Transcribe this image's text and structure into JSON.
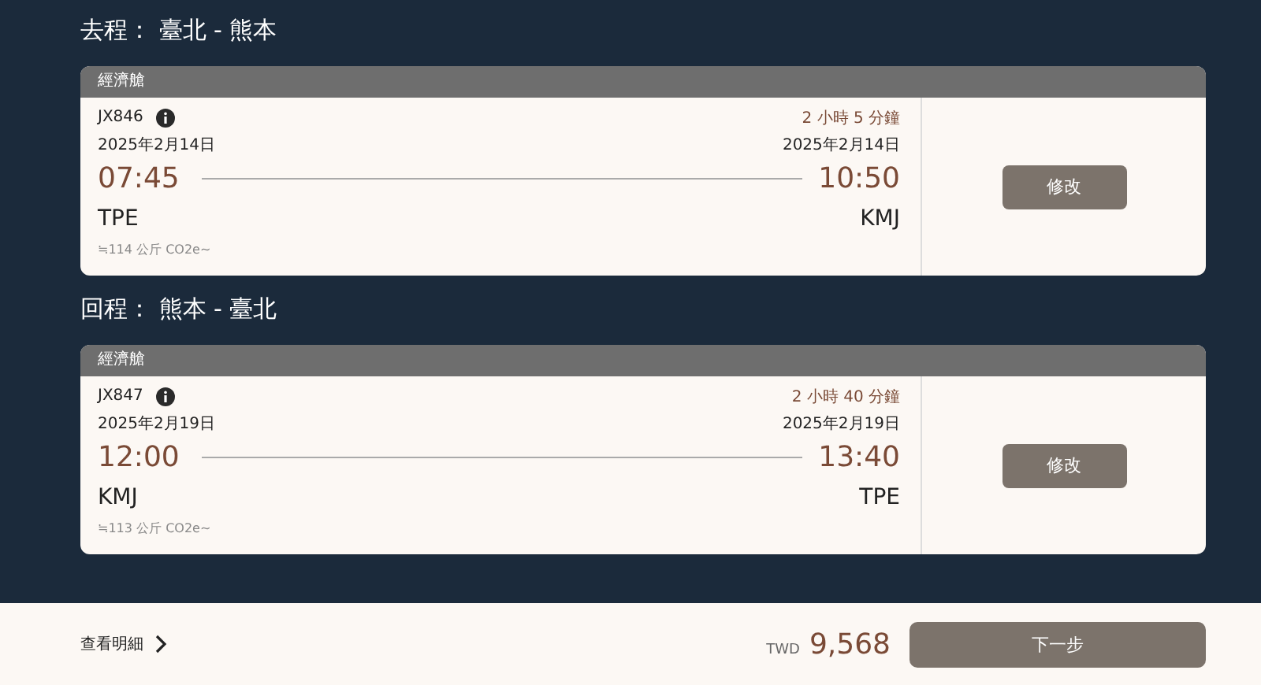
{
  "legs": [
    {
      "heading": "去程： 臺北 - 熊本",
      "cabin": "經濟艙",
      "flight": "JX846",
      "duration": "2 小時 5 分鐘",
      "dep_date": "2025年2月14日",
      "arr_date": "2025年2月14日",
      "dep_time": "07:45",
      "arr_time": "10:50",
      "dep_code": "TPE",
      "arr_code": "KMJ",
      "emission": "≒114 公斤 CO2e~",
      "button": "修改"
    },
    {
      "heading": "回程： 熊本 - 臺北",
      "cabin": "經濟艙",
      "flight": "JX847",
      "duration": "2 小時 40 分鐘",
      "dep_date": "2025年2月19日",
      "arr_date": "2025年2月19日",
      "dep_time": "12:00",
      "arr_time": "13:40",
      "dep_code": "KMJ",
      "arr_code": "TPE",
      "emission": "≒113 公斤 CO2e~",
      "button": "修改"
    }
  ],
  "footer": {
    "details_link": "查看明細",
    "currency": "TWD",
    "price": "9,568",
    "next_button": "下一步"
  }
}
